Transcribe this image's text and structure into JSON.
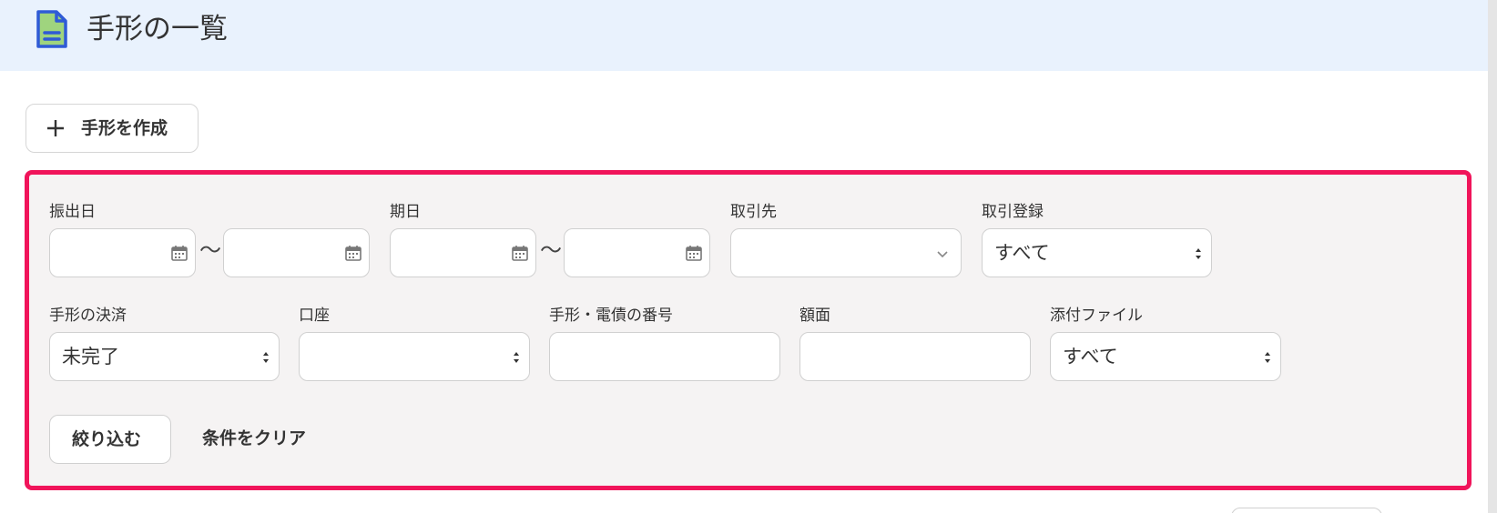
{
  "header": {
    "title": "手形の一覧",
    "icon": "document-icon",
    "accent": "#7cc36b"
  },
  "create_button": {
    "label": "手形を作成",
    "icon": "plus-icon"
  },
  "filters": {
    "issue_date": {
      "label": "振出日",
      "from": "",
      "to": "",
      "separator": "〜"
    },
    "due_date": {
      "label": "期日",
      "from": "",
      "to": "",
      "separator": "〜"
    },
    "partner": {
      "label": "取引先",
      "value": ""
    },
    "transaction_registration": {
      "label": "取引登録",
      "value": "すべて"
    },
    "settlement": {
      "label": "手形の決済",
      "value": "未完了"
    },
    "account": {
      "label": "口座",
      "value": ""
    },
    "number": {
      "label": "手形・電債の番号",
      "value": ""
    },
    "amount": {
      "label": "額面",
      "value": ""
    },
    "attachment": {
      "label": "添付ファイル",
      "value": "すべて"
    }
  },
  "actions": {
    "apply": "絞り込む",
    "clear": "条件をクリア"
  },
  "colors": {
    "header_bg": "#e9f2fd",
    "highlight_border": "#f0145a",
    "panel_bg": "#f5f3f3"
  }
}
